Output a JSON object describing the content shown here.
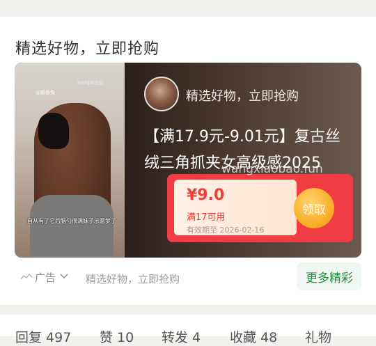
{
  "section": {
    "title": "精选好物，立即抢购"
  },
  "ad": {
    "photo_caption": "自从有了它后脑勺很满妹子示意梦了",
    "watermark_top": "HANJIE出品",
    "watermark_left": "@颜香兔",
    "name": "精选好物，立即抢购",
    "text": "【满17.9元-9.01元】复古丝绒三角抓夹女高级感2025",
    "coupon": {
      "price": "¥9.0",
      "condition": "满17可用",
      "validity": "有效期至 2026-02-16",
      "button": "领取"
    },
    "site_watermark": "wangxiaobao.fun"
  },
  "footer": {
    "ad_label": "广告",
    "text": "精选好物，立即抢购",
    "more_button": "更多精彩"
  },
  "stats": {
    "reply": "回复 497",
    "like": "赞 10",
    "share": "转发 4",
    "favorite": "收藏 48",
    "gift": "礼物"
  },
  "icons": [
    "ad-signal-icon",
    "chevron-down-icon"
  ]
}
